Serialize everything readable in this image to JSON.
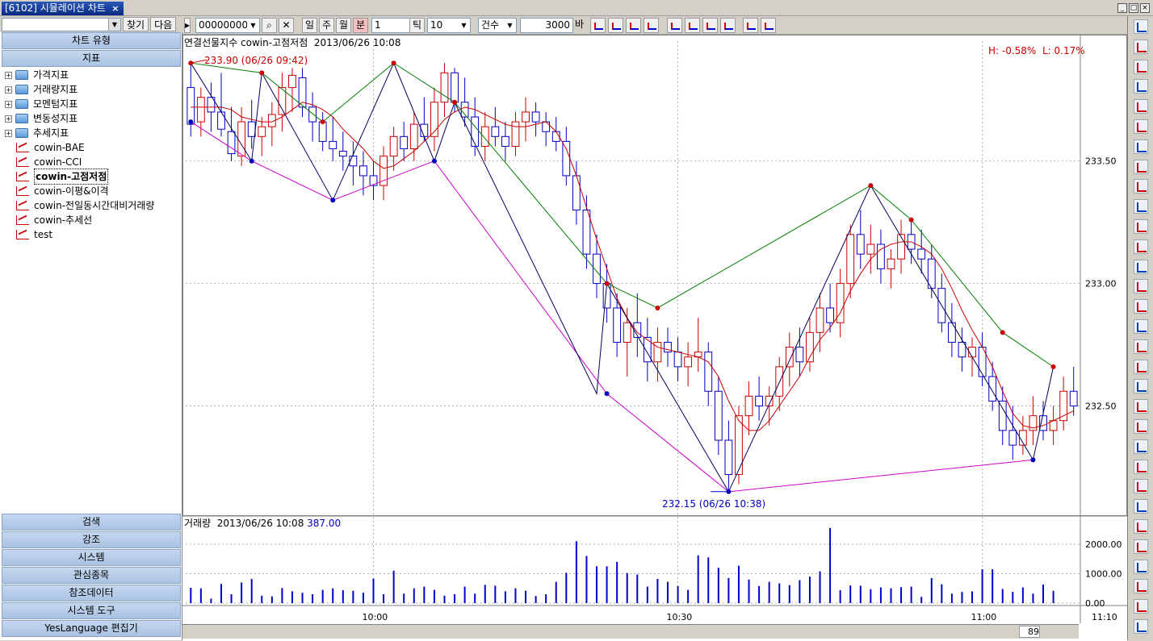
{
  "window": {
    "title": "[6102] 시뮬레이션 차트",
    "close_glyph": "×"
  },
  "left": {
    "find_label": "찾기",
    "next_label": "다음",
    "chart_type_label": "차트 유형",
    "indicator_label": "지표",
    "tree": [
      {
        "kind": "folder",
        "label": "가격지표"
      },
      {
        "kind": "folder",
        "label": "거래량지표"
      },
      {
        "kind": "folder",
        "label": "모멘텀지표"
      },
      {
        "kind": "folder",
        "label": "변동성지표"
      },
      {
        "kind": "folder",
        "label": "추세지표"
      },
      {
        "kind": "ind",
        "label": "cowin-BAE"
      },
      {
        "kind": "ind",
        "label": "cowin-CCI"
      },
      {
        "kind": "ind",
        "label": "cowin-고점저점",
        "selected": true
      },
      {
        "kind": "ind",
        "label": "cowin-이평&이격"
      },
      {
        "kind": "ind",
        "label": "cowin-전일동시간대비거래량"
      },
      {
        "kind": "ind",
        "label": "cowin-추세선"
      },
      {
        "kind": "ind",
        "label": "test"
      }
    ],
    "bottom_sections": [
      "검색",
      "강조",
      "시스템",
      "관심종목",
      "참조데이터",
      "시스템 도구",
      "YesLanguage 편집기"
    ]
  },
  "toolbar": {
    "code": "00000000",
    "period_buttons": [
      "일",
      "주",
      "월",
      "분",
      "틱"
    ],
    "minute_value": "1",
    "tick_value": "10",
    "count_label": "건수",
    "count_value": "3000",
    "count_unit": "바"
  },
  "chart": {
    "price_title": "연결선물지수 cowin-고점저점",
    "price_datetime": "2013/06/26 10:08",
    "hl_label": "H: -0.58%",
    "low_label": "L: 0.17%",
    "high_annotation": "233.90 (06/26 09:42)",
    "low_annotation": "232.15 (06/26 10:38)",
    "volume_title": "거래량",
    "volume_datetime": "2013/06/26 10:08",
    "volume_value": "387.00",
    "zoom_count": "89",
    "colors": {
      "up": "#cc0000",
      "down": "#0000c0",
      "ma": "#cc0000",
      "zigzag": "#000060",
      "high_line": "#008000",
      "low_line": "#cc00cc",
      "volume": "#0000cc"
    }
  },
  "chart_data": {
    "type": "candlestick",
    "price_axis": {
      "ticks": [
        "233.50",
        "233.00",
        "232.50"
      ],
      "tick_values": [
        233.5,
        233.0,
        232.5
      ],
      "range": [
        232.1,
        233.95
      ]
    },
    "volume_axis": {
      "ticks": [
        "2000.00",
        "1000.00",
        "0.00"
      ],
      "tick_values": [
        2000,
        1000,
        0
      ],
      "range": [
        0,
        2600
      ]
    },
    "time_axis": {
      "ticks": [
        "10:00",
        "10:30",
        "11:00",
        "11:10"
      ]
    },
    "candles": [
      [
        233.8,
        233.9,
        233.6,
        233.65
      ],
      [
        233.66,
        233.8,
        233.6,
        233.76
      ],
      [
        233.76,
        233.82,
        233.62,
        233.7
      ],
      [
        233.7,
        233.86,
        233.6,
        233.63
      ],
      [
        233.62,
        233.72,
        233.5,
        233.53
      ],
      [
        233.52,
        233.72,
        233.48,
        233.66
      ],
      [
        233.66,
        233.75,
        233.55,
        233.6
      ],
      [
        233.6,
        233.68,
        233.52,
        233.64
      ],
      [
        233.64,
        233.74,
        233.56,
        233.69
      ],
      [
        233.69,
        233.86,
        233.62,
        233.8
      ],
      [
        233.8,
        233.88,
        233.7,
        233.85
      ],
      [
        233.84,
        233.88,
        233.68,
        233.72
      ],
      [
        233.72,
        233.78,
        233.58,
        233.66
      ],
      [
        233.66,
        233.7,
        233.54,
        233.58
      ],
      [
        233.58,
        233.68,
        233.5,
        233.55
      ],
      [
        233.54,
        233.62,
        233.46,
        233.52
      ],
      [
        233.52,
        233.58,
        233.4,
        233.48
      ],
      [
        233.48,
        233.54,
        233.36,
        233.44
      ],
      [
        233.44,
        233.5,
        233.34,
        233.4
      ],
      [
        233.4,
        233.56,
        233.34,
        233.52
      ],
      [
        233.52,
        233.64,
        233.46,
        233.6
      ],
      [
        233.6,
        233.66,
        233.5,
        233.55
      ],
      [
        233.55,
        233.7,
        233.5,
        233.65
      ],
      [
        233.65,
        233.76,
        233.58,
        233.6
      ],
      [
        233.6,
        233.8,
        233.54,
        233.74
      ],
      [
        233.74,
        233.9,
        233.68,
        233.86
      ],
      [
        233.86,
        233.88,
        233.7,
        233.74
      ],
      [
        233.74,
        233.84,
        233.64,
        233.68
      ],
      [
        233.68,
        233.76,
        233.52,
        233.56
      ],
      [
        233.56,
        233.7,
        233.5,
        233.64
      ],
      [
        233.64,
        233.72,
        233.56,
        233.6
      ],
      [
        233.6,
        233.66,
        233.5,
        233.56
      ],
      [
        233.56,
        233.7,
        233.52,
        233.66
      ],
      [
        233.66,
        233.76,
        233.58,
        233.7
      ],
      [
        233.7,
        233.74,
        233.6,
        233.66
      ],
      [
        233.66,
        233.7,
        233.56,
        233.62
      ],
      [
        233.62,
        233.68,
        233.54,
        233.58
      ],
      [
        233.58,
        233.64,
        233.4,
        233.44
      ],
      [
        233.44,
        233.5,
        233.24,
        233.3
      ],
      [
        233.3,
        233.36,
        233.06,
        233.12
      ],
      [
        233.12,
        233.2,
        232.94,
        233.0
      ],
      [
        233.0,
        233.08,
        232.84,
        232.9
      ],
      [
        232.9,
        232.96,
        232.7,
        232.76
      ],
      [
        232.76,
        232.9,
        232.62,
        232.84
      ],
      [
        232.84,
        232.96,
        232.7,
        232.78
      ],
      [
        232.78,
        232.86,
        232.6,
        232.68
      ],
      [
        232.68,
        232.82,
        232.6,
        232.76
      ],
      [
        232.76,
        232.82,
        232.66,
        232.72
      ],
      [
        232.72,
        232.78,
        232.6,
        232.66
      ],
      [
        232.66,
        232.76,
        232.58,
        232.7
      ],
      [
        232.7,
        232.86,
        232.64,
        232.72
      ],
      [
        232.72,
        232.76,
        232.5,
        232.56
      ],
      [
        232.56,
        232.62,
        232.3,
        232.36
      ],
      [
        232.36,
        232.44,
        232.15,
        232.22
      ],
      [
        232.22,
        232.5,
        232.18,
        232.46
      ],
      [
        232.46,
        232.6,
        232.38,
        232.54
      ],
      [
        232.54,
        232.62,
        232.44,
        232.5
      ],
      [
        232.5,
        232.58,
        232.42,
        232.54
      ],
      [
        232.54,
        232.7,
        232.48,
        232.66
      ],
      [
        232.66,
        232.8,
        232.58,
        232.74
      ],
      [
        232.74,
        232.82,
        232.62,
        232.68
      ],
      [
        232.68,
        232.86,
        232.64,
        232.8
      ],
      [
        232.8,
        232.96,
        232.72,
        232.9
      ],
      [
        232.9,
        233.0,
        232.8,
        232.84
      ],
      [
        232.84,
        233.06,
        232.78,
        233.0
      ],
      [
        233.0,
        233.24,
        232.94,
        233.2
      ],
      [
        233.2,
        233.3,
        233.06,
        233.12
      ],
      [
        233.12,
        233.24,
        233.04,
        233.16
      ],
      [
        233.16,
        233.22,
        233.0,
        233.06
      ],
      [
        233.06,
        233.14,
        232.98,
        233.1
      ],
      [
        233.1,
        233.26,
        233.04,
        233.2
      ],
      [
        233.2,
        233.26,
        233.08,
        233.14
      ],
      [
        233.14,
        233.22,
        233.04,
        233.1
      ],
      [
        233.1,
        233.16,
        232.94,
        232.98
      ],
      [
        232.98,
        233.04,
        232.8,
        232.84
      ],
      [
        232.84,
        232.92,
        232.7,
        232.76
      ],
      [
        232.76,
        232.82,
        232.64,
        232.7
      ],
      [
        232.7,
        232.78,
        232.62,
        232.74
      ],
      [
        232.74,
        232.8,
        232.58,
        232.62
      ],
      [
        232.62,
        232.68,
        232.48,
        232.52
      ],
      [
        232.52,
        232.58,
        232.34,
        232.4
      ],
      [
        232.4,
        232.5,
        232.28,
        232.34
      ],
      [
        232.34,
        232.46,
        232.3,
        232.4
      ],
      [
        232.4,
        232.54,
        232.34,
        232.46
      ],
      [
        232.46,
        232.52,
        232.36,
        232.4
      ],
      [
        232.4,
        232.5,
        232.34,
        232.44
      ],
      [
        232.44,
        232.62,
        232.4,
        232.56
      ],
      [
        232.56,
        232.66,
        232.46,
        232.5
      ]
    ],
    "volumes": [
      520,
      500,
      150,
      650,
      300,
      700,
      820,
      250,
      230,
      510,
      400,
      350,
      300,
      450,
      500,
      440,
      420,
      350,
      830,
      300,
      1100,
      320,
      500,
      560,
      450,
      250,
      300,
      560,
      320,
      620,
      590,
      400,
      500,
      420,
      240,
      300,
      720,
      1030,
      2100,
      1600,
      1250,
      1250,
      1400,
      1020,
      970,
      560,
      820,
      720,
      580,
      450,
      1620,
      1550,
      1200,
      850,
      1270,
      800,
      580,
      720,
      670,
      610,
      780,
      900,
      1080,
      2550,
      440,
      600,
      590,
      470,
      530,
      500,
      540,
      560,
      210,
      850,
      640,
      320,
      380,
      400,
      1150,
      1150,
      480,
      380,
      530,
      320,
      630,
      420
    ],
    "ma": [
      233.72,
      233.72,
      233.72,
      233.72,
      233.71,
      233.68,
      233.67,
      233.66,
      233.66,
      233.68,
      233.71,
      233.74,
      233.73,
      233.71,
      233.68,
      233.63,
      233.59,
      233.55,
      233.5,
      233.47,
      233.48,
      233.51,
      233.54,
      233.58,
      233.62,
      233.67,
      233.7,
      233.72,
      233.71,
      233.69,
      233.67,
      233.65,
      233.64,
      233.64,
      233.65,
      233.66,
      233.62,
      233.55,
      233.44,
      233.31,
      233.18,
      233.06,
      232.94,
      232.86,
      232.8,
      232.77,
      232.74,
      232.73,
      232.72,
      232.71,
      232.7,
      232.68,
      232.62,
      232.52,
      232.44,
      232.4,
      232.4,
      232.44,
      232.5,
      232.56,
      232.62,
      232.7,
      232.77,
      232.82,
      232.88,
      232.97,
      233.04,
      233.1,
      233.14,
      233.16,
      233.17,
      233.17,
      233.15,
      233.12,
      233.06,
      232.98,
      232.89,
      232.81,
      232.74,
      232.66,
      232.56,
      232.47,
      232.42,
      232.41,
      232.42,
      232.44,
      232.46,
      232.48
    ],
    "swing_highs": [
      [
        0,
        233.9
      ],
      [
        7,
        233.86
      ],
      [
        13,
        233.66
      ],
      [
        20,
        233.9
      ],
      [
        26,
        233.74
      ],
      [
        41,
        233.0
      ],
      [
        46,
        232.9
      ],
      [
        67,
        233.4
      ],
      [
        71,
        233.26
      ],
      [
        80,
        232.8
      ],
      [
        85,
        232.66
      ]
    ],
    "swing_lows": [
      [
        0,
        233.66
      ],
      [
        6,
        233.5
      ],
      [
        14,
        233.34
      ],
      [
        24,
        233.5
      ],
      [
        41,
        232.55
      ],
      [
        53,
        232.15
      ],
      [
        83,
        232.28
      ]
    ],
    "zigzag": [
      [
        0,
        233.9
      ],
      [
        6,
        233.5
      ],
      [
        7,
        233.86
      ],
      [
        14,
        233.34
      ],
      [
        20,
        233.9
      ],
      [
        24,
        233.5
      ],
      [
        26,
        233.74
      ],
      [
        40,
        232.55
      ],
      [
        41,
        233.0
      ],
      [
        53,
        232.15
      ],
      [
        67,
        233.4
      ],
      [
        83,
        232.28
      ],
      [
        85,
        232.66
      ]
    ]
  }
}
